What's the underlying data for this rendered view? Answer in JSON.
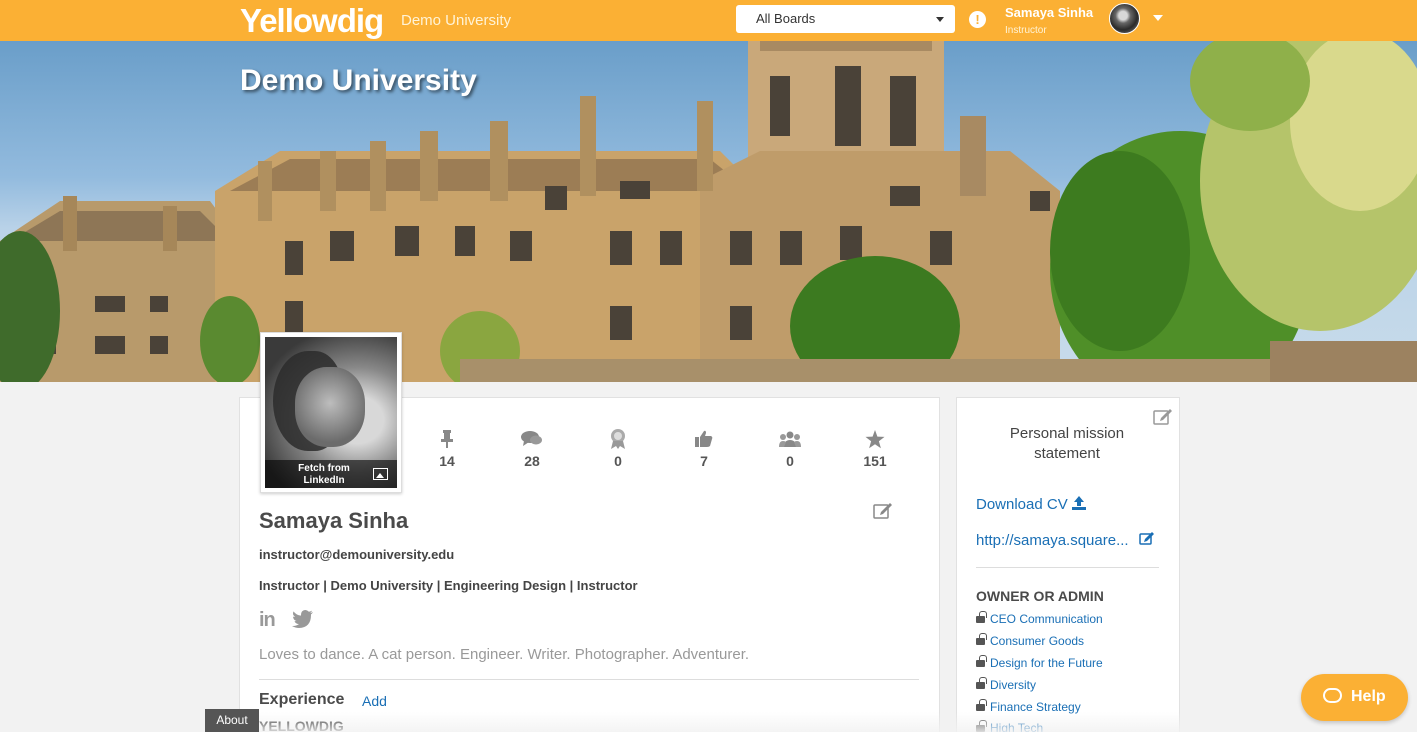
{
  "app": {
    "logo": "Yellowdig",
    "org_name": "Demo University",
    "board_select": "All Boards",
    "alert_icon": "exclamation-circle-icon",
    "user_name": "Samaya Sinha",
    "user_role": "Instructor",
    "brand_color": "#fbb034"
  },
  "banner": {
    "title": "Demo University"
  },
  "profile": {
    "fetch_label": "Fetch from LinkedIn",
    "name": "Samaya Sinha",
    "email": "instructor@demouniversity.edu",
    "meta": "Instructor | Demo University | Engineering Design | Instructor",
    "linkedin": "in",
    "bio": "Loves to dance. A cat person. Engineer. Writer. Photographer. Adventurer.",
    "stats": [
      {
        "icon": "pin-icon",
        "value": "14"
      },
      {
        "icon": "comments-icon",
        "value": "28"
      },
      {
        "icon": "badge-icon",
        "value": "0"
      },
      {
        "icon": "thumbs-up-icon",
        "value": "7"
      },
      {
        "icon": "group-icon",
        "value": "0"
      },
      {
        "icon": "star-icon",
        "value": "151"
      }
    ],
    "experience_title": "Experience",
    "experience_add": "Add",
    "experience_org": "YELLOWDIG"
  },
  "side": {
    "mission": "Personal mission statement",
    "download_cv": "Download CV",
    "website": "http://samaya.square...",
    "owner_title": "OWNER OR ADMIN",
    "boards": [
      "CEO Communication",
      "Consumer Goods",
      "Design for the Future",
      "Diversity",
      "Finance Strategy",
      "High Tech"
    ]
  },
  "footer": {
    "about": "About",
    "help": "Help"
  }
}
